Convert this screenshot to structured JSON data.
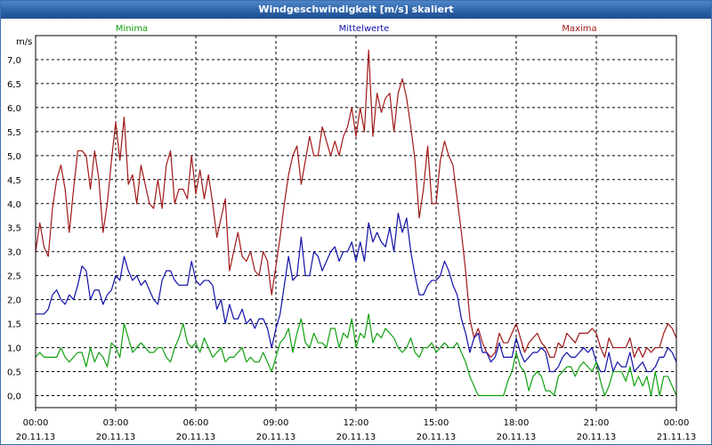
{
  "window": {
    "title": "Windgeschwindigkeit [m/s] skaliert"
  },
  "chart_data": {
    "type": "line",
    "title": "Windgeschwindigkeit [m/s] skaliert",
    "ylabel": "m/s",
    "xlabel": "",
    "ylim": [
      -0.25,
      7.5
    ],
    "xlim": [
      0,
      24
    ],
    "y_ticks": [
      0,
      0.5,
      1,
      1.5,
      2,
      2.5,
      3,
      3.5,
      4,
      4.5,
      5,
      5.5,
      6,
      6.5,
      7
    ],
    "y_tick_labels": [
      "0,0",
      "0,5",
      "1,0",
      "1,5",
      "2,0",
      "2,5",
      "3,0",
      "3,5",
      "4,0",
      "4,5",
      "5,0",
      "5,5",
      "6,0",
      "6,5",
      "7,0"
    ],
    "x_ticks": [
      {
        "x": 0,
        "time": "00:00",
        "date": "20.11.13"
      },
      {
        "x": 3,
        "time": "03:00",
        "date": "20.11.13"
      },
      {
        "x": 6,
        "time": "06:00",
        "date": "20.11.13"
      },
      {
        "x": 9,
        "time": "09:00",
        "date": "20.11.13"
      },
      {
        "x": 12,
        "time": "12:00",
        "date": "20.11.13"
      },
      {
        "x": 15,
        "time": "15:00",
        "date": "20.11.13"
      },
      {
        "x": 18,
        "time": "18:00",
        "date": "20.11.13"
      },
      {
        "x": 21,
        "time": "21:00",
        "date": "20.11.13"
      },
      {
        "x": 24,
        "time": "00:00",
        "date": "21.11.13"
      }
    ],
    "grid": true,
    "series": [
      {
        "name": "Maxima",
        "color": "#a01818",
        "values": [
          3.0,
          3.6,
          3.1,
          2.9,
          3.9,
          4.5,
          4.8,
          4.3,
          3.4,
          4.3,
          5.1,
          5.1,
          5.0,
          4.3,
          5.1,
          4.5,
          3.4,
          4.0,
          4.9,
          5.7,
          4.9,
          5.8,
          4.4,
          4.6,
          4.0,
          4.8,
          4.4,
          4.0,
          3.9,
          4.5,
          3.9,
          4.8,
          5.1,
          4.0,
          4.3,
          4.3,
          4.1,
          5.0,
          4.2,
          4.7,
          4.1,
          4.6,
          4.0,
          3.3,
          3.7,
          4.1,
          2.6,
          3.0,
          3.4,
          2.9,
          2.8,
          3.0,
          2.6,
          2.5,
          3.0,
          2.8,
          2.1,
          2.7,
          3.3,
          4.0,
          4.6,
          5.0,
          5.2,
          4.4,
          4.9,
          5.4,
          5.0,
          5.0,
          5.6,
          5.3,
          5.0,
          5.3,
          5.0,
          5.4,
          5.6,
          6.0,
          5.4,
          6.0,
          5.5,
          7.2,
          5.4,
          6.3,
          5.9,
          6.2,
          6.3,
          5.5,
          6.3,
          6.6,
          6.2,
          5.6,
          4.9,
          3.7,
          4.3,
          5.2,
          4.0,
          4.0,
          4.9,
          5.3,
          5.0,
          4.8,
          4.1,
          3.4,
          2.6,
          1.6,
          1.2,
          1.4,
          1.1,
          0.9,
          0.8,
          0.9,
          1.3,
          1.1,
          1.1,
          1.3,
          1.5,
          1.2,
          0.9,
          1.1,
          1.2,
          1.3,
          1.1,
          1.0,
          0.8,
          0.8,
          1.1,
          1.0,
          1.3,
          1.2,
          1.1,
          1.3,
          1.3,
          1.3,
          1.4,
          1.3,
          1.0,
          0.8,
          1.2,
          1.0,
          1.0,
          1.0,
          1.0,
          1.2,
          0.8,
          1.0,
          0.8,
          1.0,
          0.9,
          1.0,
          1.0,
          1.3,
          1.5,
          1.4,
          1.2
        ]
      },
      {
        "name": "Mittelwerte",
        "color": "#1010a8",
        "values": [
          1.7,
          1.7,
          1.7,
          1.8,
          2.1,
          2.2,
          2.0,
          1.9,
          2.1,
          2.0,
          2.3,
          2.7,
          2.6,
          2.0,
          2.2,
          2.2,
          1.9,
          2.1,
          2.2,
          2.5,
          2.4,
          2.9,
          2.6,
          2.4,
          2.5,
          2.3,
          2.4,
          2.2,
          2.0,
          1.9,
          2.4,
          2.6,
          2.6,
          2.4,
          2.3,
          2.3,
          2.3,
          2.8,
          2.4,
          2.3,
          2.4,
          2.4,
          2.3,
          1.8,
          2.0,
          1.5,
          1.9,
          1.6,
          1.6,
          1.8,
          1.5,
          1.6,
          1.4,
          1.6,
          1.6,
          1.4,
          1.0,
          1.4,
          1.7,
          2.3,
          2.9,
          2.4,
          2.5,
          3.3,
          2.5,
          2.5,
          3.0,
          2.9,
          2.6,
          2.8,
          3.0,
          3.1,
          2.8,
          3.0,
          3.0,
          3.2,
          2.8,
          3.2,
          2.8,
          3.6,
          3.2,
          3.4,
          3.2,
          3.1,
          3.5,
          3.0,
          3.8,
          3.4,
          3.7,
          3.0,
          2.5,
          2.1,
          2.1,
          2.3,
          2.4,
          2.4,
          2.5,
          2.8,
          2.6,
          2.3,
          2.1,
          1.6,
          1.3,
          0.9,
          1.2,
          1.3,
          0.9,
          0.9,
          0.7,
          0.8,
          1.1,
          0.8,
          0.8,
          0.8,
          1.2,
          0.9,
          0.7,
          0.8,
          0.9,
          0.9,
          1.0,
          0.9,
          0.5,
          0.5,
          0.6,
          0.8,
          0.9,
          0.8,
          0.8,
          0.9,
          1.0,
          0.9,
          1.0,
          0.7,
          0.5,
          0.5,
          0.9,
          0.5,
          0.7,
          0.6,
          0.6,
          0.9,
          0.5,
          0.6,
          0.7,
          0.5,
          0.5,
          0.6,
          0.8,
          0.8,
          1.0,
          0.9,
          0.7
        ]
      },
      {
        "name": "Minima",
        "color": "#10a010",
        "values": [
          0.8,
          0.9,
          0.8,
          0.8,
          0.8,
          0.8,
          1.0,
          0.8,
          0.7,
          0.8,
          0.9,
          0.9,
          0.6,
          1.0,
          0.7,
          0.9,
          0.8,
          0.6,
          1.1,
          1.0,
          0.8,
          1.5,
          1.2,
          0.9,
          1.0,
          1.1,
          1.0,
          0.9,
          0.9,
          1.0,
          1.0,
          0.8,
          0.7,
          1.0,
          1.2,
          1.5,
          1.1,
          1.0,
          1.1,
          0.9,
          1.2,
          1.0,
          0.8,
          0.9,
          1.0,
          0.7,
          0.8,
          0.8,
          0.9,
          1.0,
          0.7,
          0.8,
          0.7,
          0.7,
          0.9,
          0.7,
          0.5,
          0.8,
          1.1,
          1.2,
          1.4,
          0.9,
          1.3,
          1.6,
          1.1,
          1.0,
          1.3,
          1.1,
          1.1,
          1.0,
          1.4,
          1.4,
          1.0,
          1.3,
          1.2,
          1.6,
          1.0,
          1.3,
          1.2,
          1.7,
          1.1,
          1.3,
          1.2,
          1.4,
          1.3,
          1.2,
          1.0,
          0.9,
          1.0,
          1.2,
          0.9,
          0.8,
          1.0,
          1.0,
          1.1,
          0.9,
          1.0,
          1.1,
          1.0,
          1.0,
          1.1,
          0.9,
          0.7,
          0.4,
          0.2,
          0.0,
          0.0,
          0.0,
          0.0,
          0.0,
          0.0,
          0.0,
          0.3,
          0.5,
          0.9,
          0.6,
          0.5,
          0.1,
          0.4,
          0.5,
          0.4,
          0.1,
          0.1,
          0.0,
          0.4,
          0.5,
          0.6,
          0.6,
          0.4,
          0.6,
          0.7,
          0.6,
          0.5,
          0.7,
          0.3,
          0.0,
          0.2,
          0.5,
          0.5,
          0.5,
          0.3,
          0.6,
          0.2,
          0.4,
          0.2,
          0.4,
          0.0,
          0.5,
          0.0,
          0.4,
          0.4,
          0.2,
          0.0
        ]
      }
    ]
  }
}
